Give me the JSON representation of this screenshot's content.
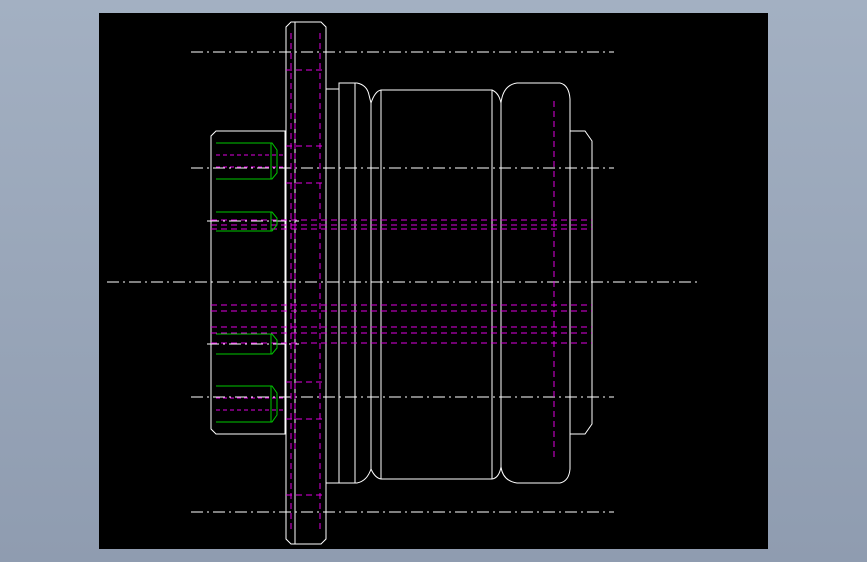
{
  "viewer": {
    "background_color": "#97a4b8",
    "canvas_color": "#000000"
  },
  "drawing": {
    "part": "flange-shaft-side-view",
    "line_colors": {
      "outline": "#ffffff",
      "hidden": "#e000e0",
      "thread": "#00c800",
      "centerline": "#ffffff"
    },
    "hole_count_visible": 4
  }
}
